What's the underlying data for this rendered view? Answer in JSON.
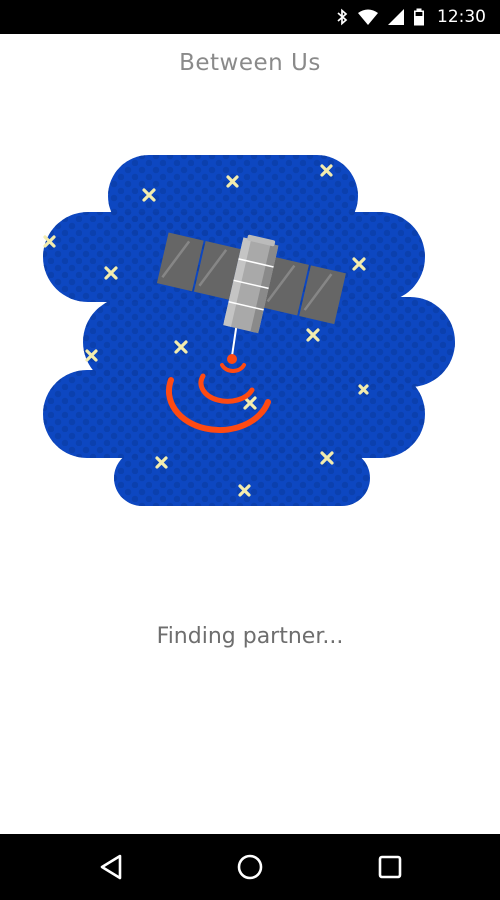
{
  "status_bar": {
    "time": "12:30",
    "icons": [
      "bluetooth-icon",
      "wifi-icon",
      "signal-icon",
      "battery-icon"
    ]
  },
  "app": {
    "title": "Between Us"
  },
  "illustration": {
    "subject": "satellite-icon",
    "colors": {
      "sky": "#0d47c1",
      "stars": "#f3ecae",
      "signal": "#ff4a12",
      "panel": "#666666",
      "body": "#a9a9a9"
    }
  },
  "main": {
    "status_message": "Finding partner..."
  },
  "nav_bar": {
    "buttons": [
      "back-icon",
      "home-icon",
      "recents-icon"
    ]
  }
}
